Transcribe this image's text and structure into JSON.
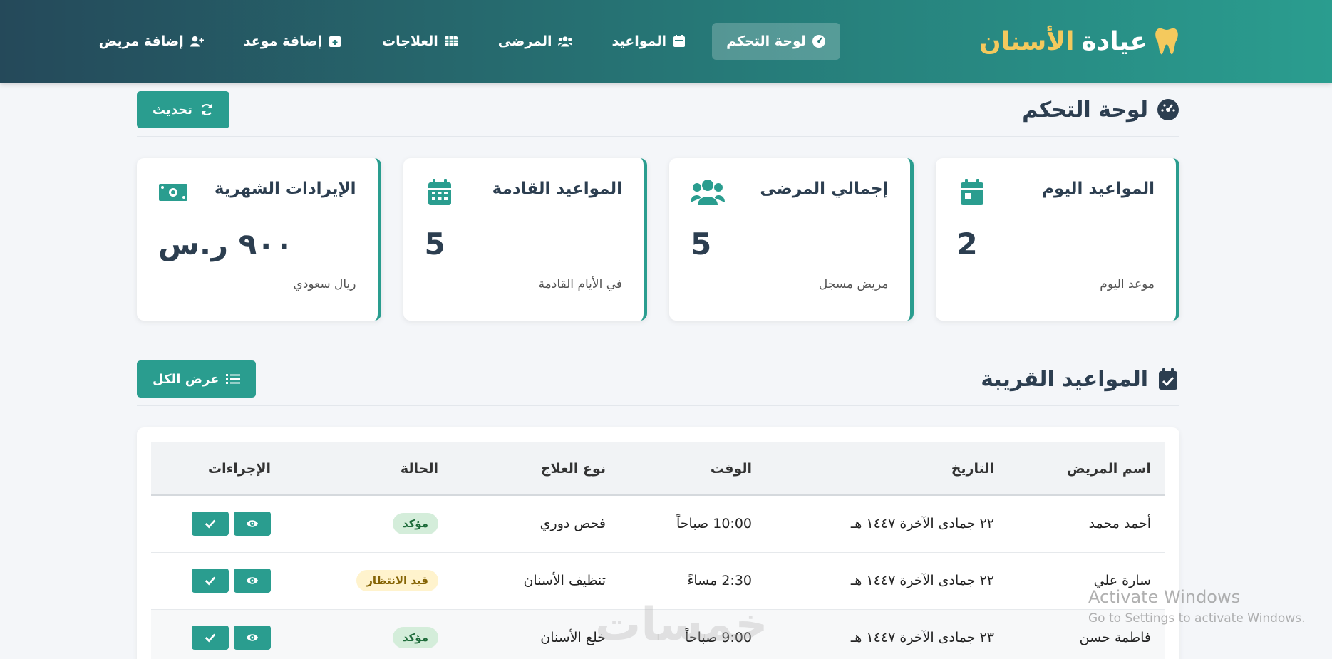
{
  "brand": {
    "name_part1": "عيادة",
    "name_part2": "الأسنان"
  },
  "nav": {
    "dashboard": "لوحة التحكم",
    "appointments": "المواعيد",
    "patients": "المرضى",
    "treatments": "العلاجات",
    "add_appointment": "إضافة موعد",
    "add_patient": "إضافة مريض"
  },
  "dashboard": {
    "title": "لوحة التحكم",
    "refresh_label": "تحديث"
  },
  "stats": [
    {
      "title": "المواعيد اليوم",
      "value": "2",
      "sub": "موعد اليوم",
      "icon": "calendar-day-icon"
    },
    {
      "title": "إجمالي المرضى",
      "value": "5",
      "sub": "مريض مسجل",
      "icon": "users-icon"
    },
    {
      "title": "المواعيد القادمة",
      "value": "5",
      "sub": "في الأيام القادمة",
      "icon": "calendar-icon"
    },
    {
      "title": "الإيرادات الشهرية",
      "value": "٩٠٠ ر.س",
      "sub": "ريال سعودي",
      "icon": "money-icon"
    }
  ],
  "upcoming": {
    "title": "المواعيد القريبة",
    "view_all_label": "عرض الكل"
  },
  "table": {
    "headers": [
      "اسم المريض",
      "التاريخ",
      "الوقت",
      "نوع العلاج",
      "الحالة",
      "الإجراءات"
    ],
    "rows": [
      {
        "patient": "أحمد محمد",
        "date": "٢٢ جمادى الآخرة ١٤٤٧ هـ",
        "time": "10:00 صباحاً",
        "treatment": "فحص دوري",
        "status": "مؤكد"
      },
      {
        "patient": "سارة علي",
        "date": "٢٢ جمادى الآخرة ١٤٤٧ هـ",
        "time": "2:30 مساءً",
        "treatment": "تنظيف الأسنان",
        "status": "قيد الانتظار"
      },
      {
        "patient": "فاطمة حسن",
        "date": "٢٣ جمادى الآخرة ١٤٤٧ هـ",
        "time": "9:00 صباحاً",
        "treatment": "خلع الأسنان",
        "status": "مؤكد"
      }
    ]
  },
  "watermark": {
    "line1": "Activate Windows",
    "line2": "Go to Settings to activate Windows.",
    "ghost_text": "خمسات"
  },
  "colors": {
    "accent": "#2a9d8f",
    "brand_gold": "#f4c95d",
    "nav_dark": "#25495a",
    "confirmed_bg": "#d4edda",
    "pending_bg": "#fff3cd"
  }
}
